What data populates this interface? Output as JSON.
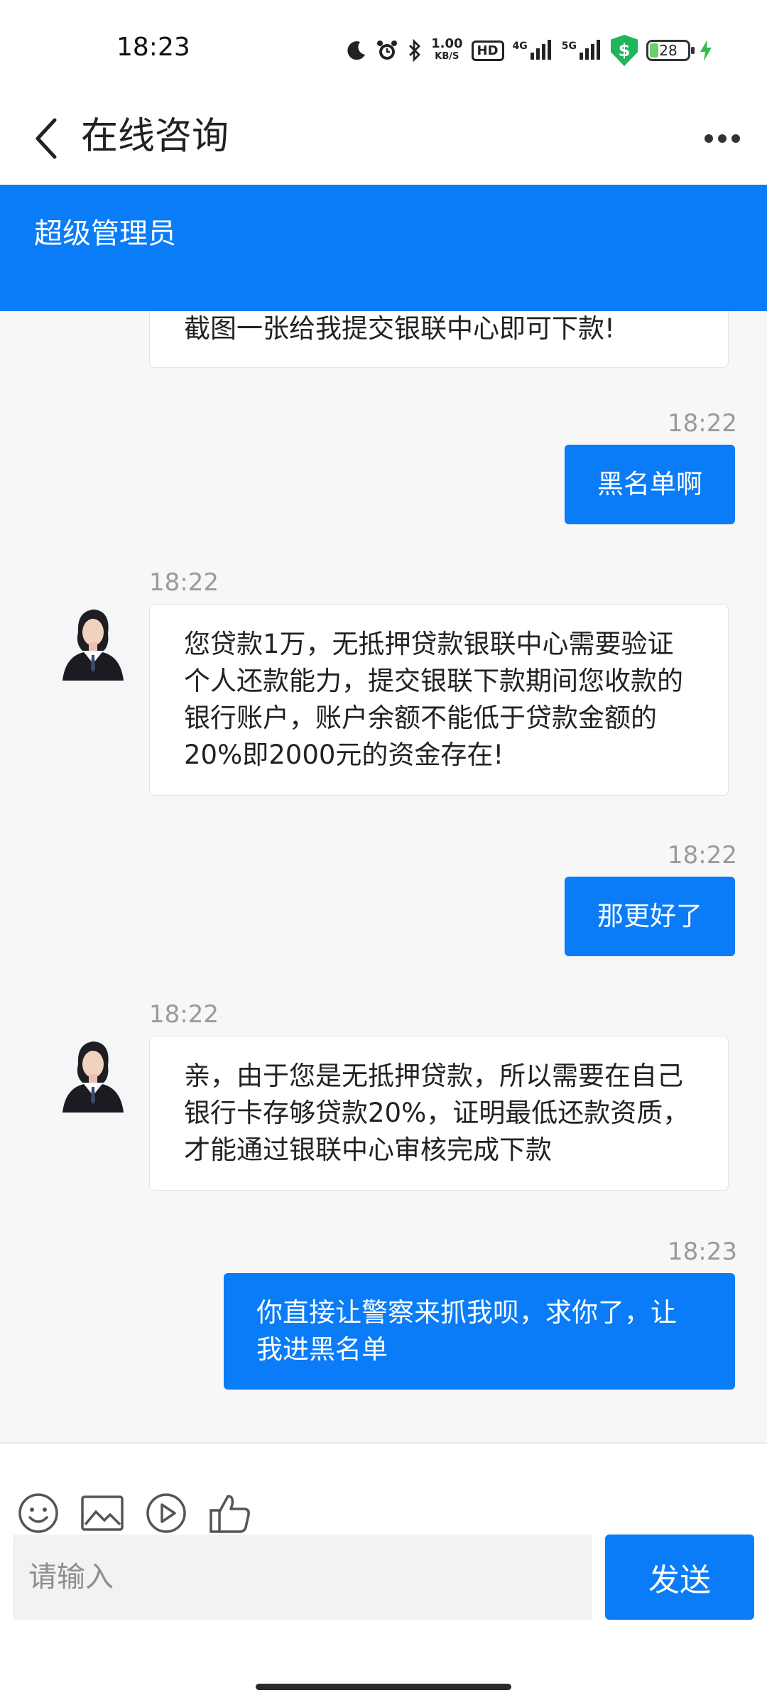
{
  "status_bar": {
    "time": "18:23",
    "net_speed_top": "1.00",
    "net_speed_unit": "KB/S",
    "hd_label": "HD",
    "signal_4g": "4G",
    "signal_5g": "5G",
    "battery_level": "28",
    "icons": [
      "moon-icon",
      "alarm-icon",
      "bluetooth-icon",
      "hd-icon",
      "signal-4g-icon",
      "signal-5g-icon",
      "security-shield-icon",
      "battery-icon",
      "charging-icon"
    ]
  },
  "header": {
    "title": "在线咨询"
  },
  "banner": {
    "name": "超级管理员"
  },
  "messages": [
    {
      "side": "in",
      "time": "",
      "text": "截图一张给我提交银联中心即可下款!"
    },
    {
      "side": "out",
      "time": "18:22",
      "text": "黑名单啊"
    },
    {
      "side": "in",
      "time": "18:22",
      "text": "您贷款1万，无抵押贷款银联中心需要验证个人还款能力，提交银联下款期间您收款的银行账户，账户余额不能低于贷款金额的20%即2000元的资金存在!"
    },
    {
      "side": "out",
      "time": "18:22",
      "text": "那更好了"
    },
    {
      "side": "in",
      "time": "18:22",
      "text": "亲，由于您是无抵押贷款，所以需要在自己银行卡存够贷款20%，证明最低还款资质，才能通过银联中心审核完成下款"
    },
    {
      "side": "out",
      "time": "18:23",
      "text": "你直接让警察来抓我呗，求你了，让我进黑名单"
    }
  ],
  "composer": {
    "placeholder": "请输入",
    "send_label": "发送",
    "tools": [
      "emoji-icon",
      "image-icon",
      "video-icon",
      "thumbs-up-icon"
    ]
  },
  "colors": {
    "accent": "#0a7cf7",
    "background": "#f7f7f8"
  }
}
